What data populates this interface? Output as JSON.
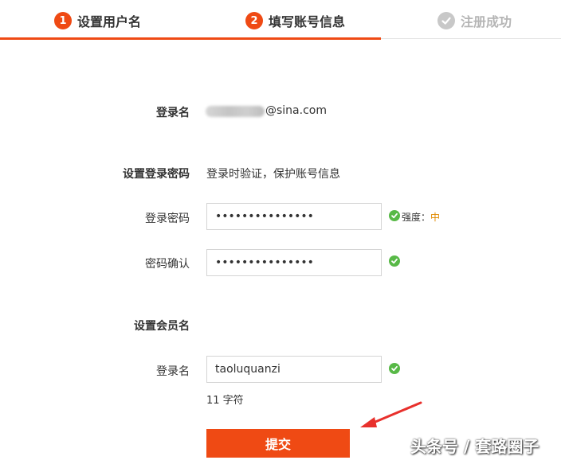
{
  "steps": [
    {
      "num": "1",
      "label": "设置用户名"
    },
    {
      "num": "2",
      "label": "填写账号信息"
    },
    {
      "label": "注册成功"
    }
  ],
  "colors": {
    "accent": "#ef4a14",
    "success": "#58b947",
    "strength_mid": "#e08a00"
  },
  "login": {
    "label": "登录名",
    "email_suffix": "@sina.com"
  },
  "password_section": {
    "title": "设置登录密码",
    "hint": "登录时验证，保护账号信息",
    "password_label": "登录密码",
    "password_value": "•••••••••••••••",
    "confirm_label": "密码确认",
    "confirm_value": "•••••••••••••••",
    "strength_label": "强度：",
    "strength_value": "中"
  },
  "member_section": {
    "title": "设置会员名",
    "name_label": "登录名",
    "name_value": "taoluquanzi",
    "char_count": "11 字符"
  },
  "submit_label": "提交",
  "watermark": "头条号 / 套路圈子"
}
